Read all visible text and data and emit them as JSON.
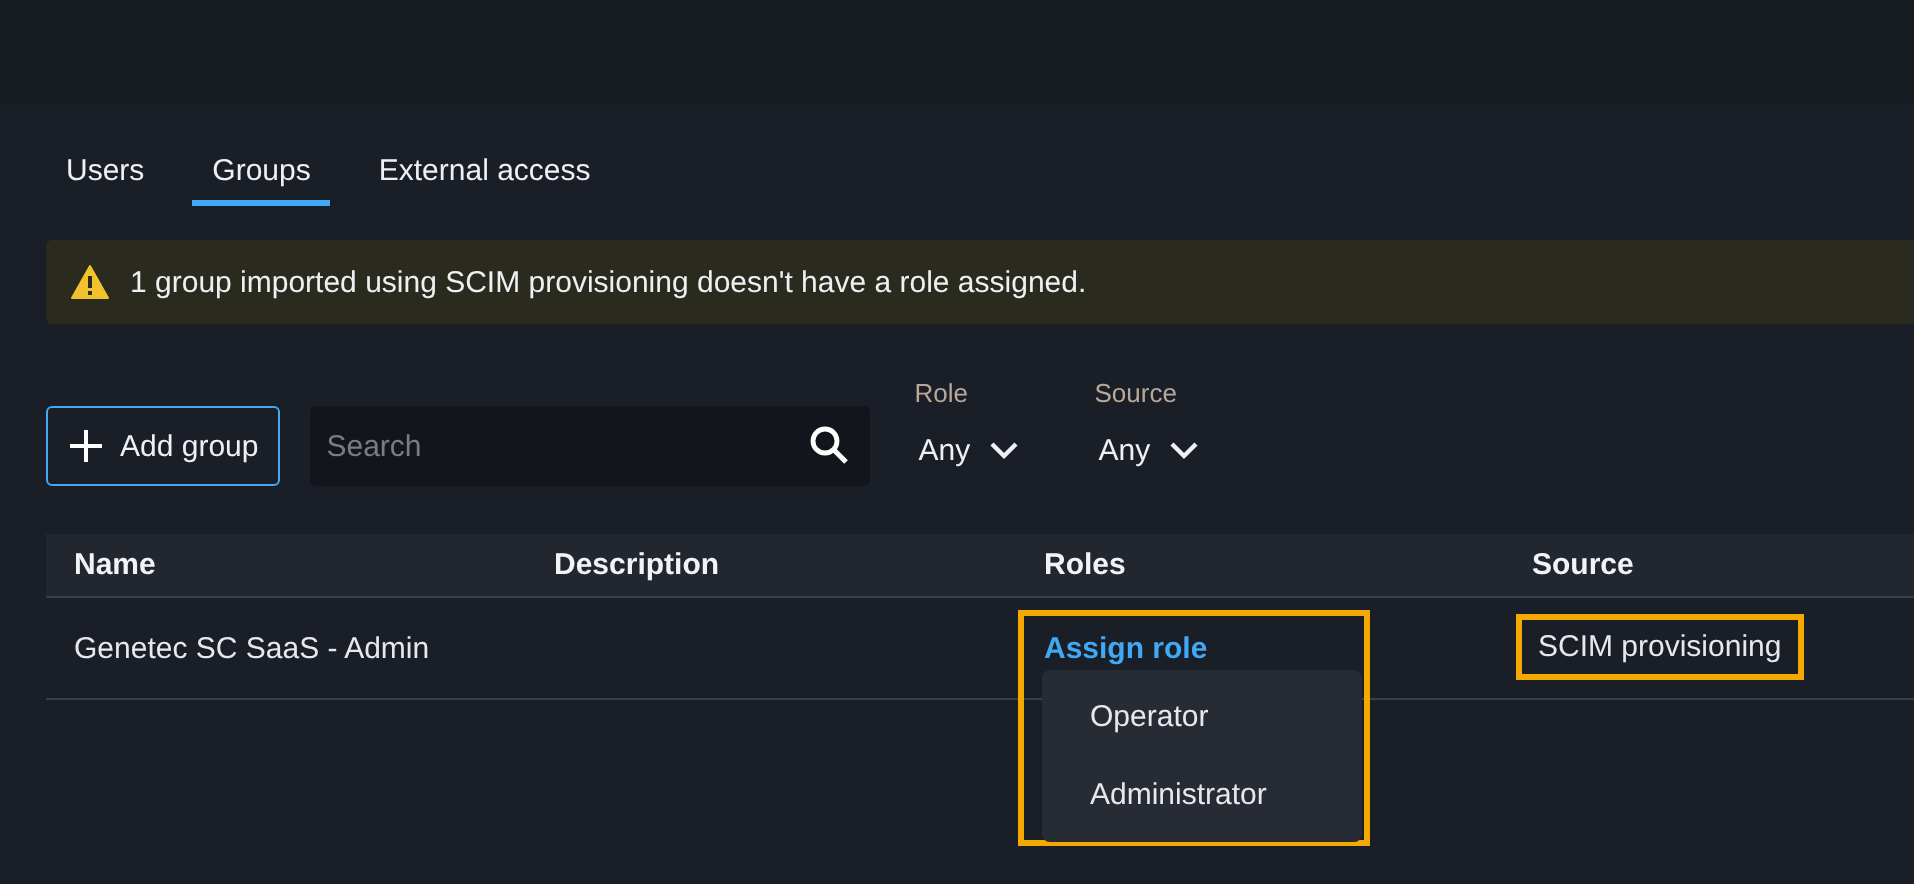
{
  "tabs": [
    {
      "label": "Users",
      "selected": false
    },
    {
      "label": "Groups",
      "selected": true
    },
    {
      "label": "External access",
      "selected": false
    }
  ],
  "alert": {
    "text": "1 group imported using SCIM provisioning doesn't have a role assigned."
  },
  "toolbar": {
    "add_button": "Add group",
    "search": {
      "placeholder": "Search"
    },
    "filters": [
      {
        "label": "Role",
        "value": "Any"
      },
      {
        "label": "Source",
        "value": "Any"
      }
    ]
  },
  "table": {
    "columns": [
      "Name",
      "Description",
      "Roles",
      "Source"
    ],
    "rows": [
      {
        "name": "Genetec SC SaaS - Admin",
        "description": "",
        "roles": {
          "link": "Assign role",
          "highlighted": true,
          "menu": [
            "Operator",
            "Administrator"
          ]
        },
        "source": {
          "text": "SCIM provisioning",
          "highlighted": true
        }
      }
    ]
  }
}
